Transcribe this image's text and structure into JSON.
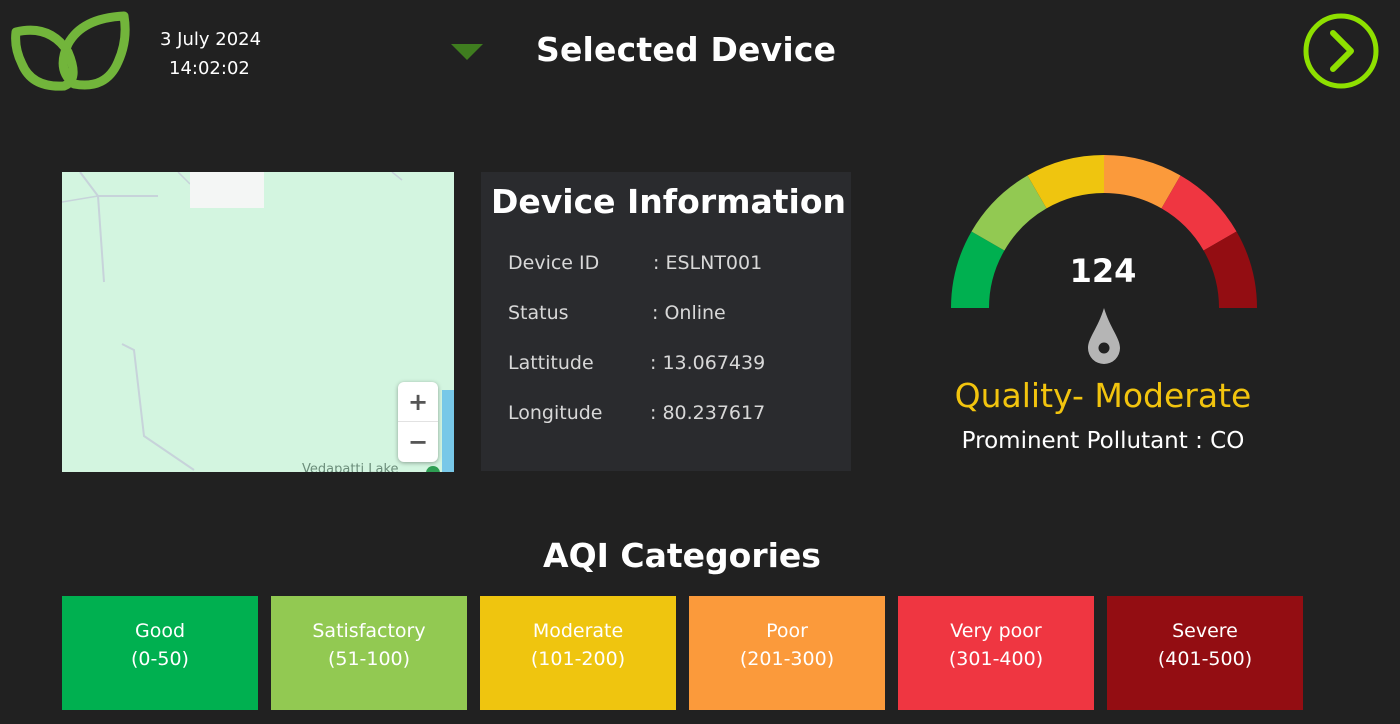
{
  "header": {
    "date": "3 July 2024",
    "time": "14:02:02",
    "title": "Selected Device"
  },
  "map": {
    "zoom_in_label": "+",
    "zoom_out_label": "−",
    "place_label": "Vedapatti Lake"
  },
  "device_info": {
    "title": "Device Information",
    "rows": [
      {
        "label": "Device ID",
        "value": ": ESLNT001"
      },
      {
        "label": "Status",
        "value": ":  Online"
      },
      {
        "label": "Lattitude",
        "value": ": 13.067439"
      },
      {
        "label": "Longitude",
        "value": ": 80.237617"
      }
    ]
  },
  "gauge": {
    "value": "124",
    "quality": "Quality- Moderate",
    "pollutant": "Prominent Pollutant :  CO",
    "segment_colors": [
      "#00b050",
      "#92c952",
      "#efc50f",
      "#fb9a3b",
      "#ef3641",
      "#930d12"
    ]
  },
  "aqi": {
    "title": "AQI Categories",
    "categories": [
      {
        "name": "Good",
        "range": "(0-50)",
        "color": "#00b050"
      },
      {
        "name": "Satisfactory",
        "range": "(51-100)",
        "color": "#92c952"
      },
      {
        "name": "Moderate",
        "range": "(101-200)",
        "color": "#efc50f"
      },
      {
        "name": "Poor",
        "range": "(201-300)",
        "color": "#fb9a3b"
      },
      {
        "name": "Very poor",
        "range": "(301-400)",
        "color": "#ef3641"
      },
      {
        "name": "Severe",
        "range": "(401-500)",
        "color": "#930d12"
      }
    ]
  },
  "colors": {
    "accent_green": "#8ee000",
    "logo_green": "#6db33f",
    "background": "#212121"
  },
  "icons": {
    "logo": "leaf-logo-icon",
    "dropdown": "triangle-down-icon",
    "next": "chevron-right-icon",
    "needle": "needle-icon"
  }
}
